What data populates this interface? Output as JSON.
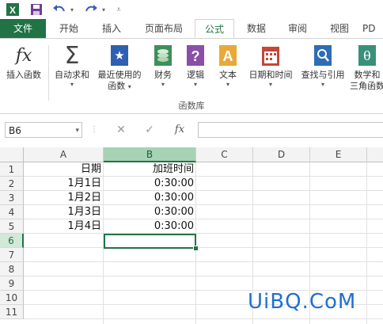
{
  "quick_access": {
    "icons": [
      "excel-logo-icon",
      "save-icon",
      "undo-icon",
      "redo-icon",
      "customize-icon"
    ]
  },
  "ribbon_tabs": [
    {
      "label": "文件"
    },
    {
      "label": "开始"
    },
    {
      "label": "插入"
    },
    {
      "label": "页面布局"
    },
    {
      "label": "公式"
    },
    {
      "label": "数据"
    },
    {
      "label": "审阅"
    },
    {
      "label": "视图"
    },
    {
      "label": "PD"
    }
  ],
  "ribbon": {
    "insert_function": {
      "label": "插入函数",
      "icon_text": "fx"
    },
    "autosum": {
      "label": "自动求和",
      "icon_text": "Σ"
    },
    "recently_used": {
      "label": "最近使用的",
      "label2": "函数"
    },
    "financial": {
      "label": "财务"
    },
    "logical": {
      "label": "逻辑",
      "icon_text": "?"
    },
    "text": {
      "label": "文本",
      "icon_text": "A"
    },
    "date_time": {
      "label": "日期和时间"
    },
    "lookup": {
      "label": "查找与引用"
    },
    "math": {
      "label": "数学和",
      "label2": "三角函数",
      "icon_text": "θ"
    },
    "group_label": "函数库",
    "accent": "#217346"
  },
  "formula_bar": {
    "name_box": "B6",
    "cancel": "✕",
    "enter": "✓",
    "fx": "fx",
    "value": ""
  },
  "grid": {
    "columns": [
      "A",
      "B",
      "C",
      "D",
      "E"
    ],
    "rows": [
      "1",
      "2",
      "3",
      "4",
      "5",
      "6",
      "7",
      "8",
      "9",
      "10",
      "11"
    ],
    "cells": {
      "A1": "日期",
      "B1": "加班时间",
      "A2": "1月1日",
      "B2": "0:30:00",
      "A3": "1月2日",
      "B3": "0:30:00",
      "A4": "1月3日",
      "B4": "0:30:00",
      "A5": "1月4日",
      "B5": "0:30:00"
    },
    "selected_cell": "B6"
  },
  "watermark": "UiBQ.CoM"
}
